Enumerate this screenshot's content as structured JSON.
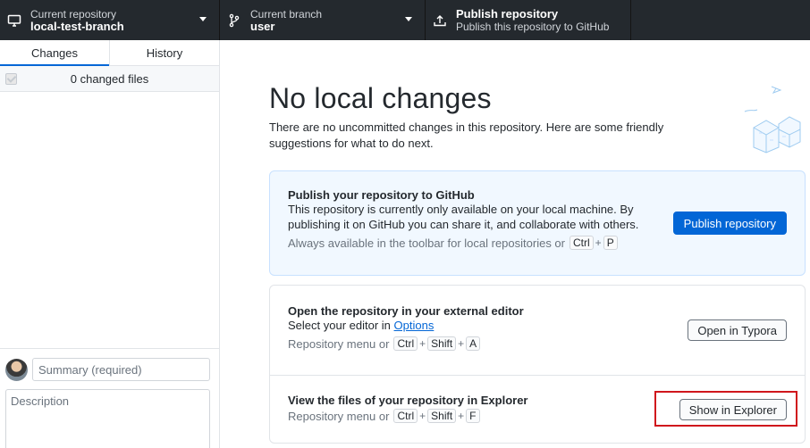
{
  "toolbar": {
    "repo": {
      "label": "Current repository",
      "value": "local-test-branch"
    },
    "branch": {
      "label": "Current branch",
      "value": "user"
    },
    "publish": {
      "label": "Publish repository",
      "desc": "Publish this repository to GitHub"
    }
  },
  "sidebar": {
    "tabs": [
      {
        "label": "Changes",
        "active": true
      },
      {
        "label": "History",
        "active": false
      }
    ],
    "changes_count": "0 changed files",
    "commit": {
      "summary_placeholder": "Summary (required)",
      "description_placeholder": "Description"
    }
  },
  "main": {
    "title": "No local changes",
    "subtitle": "There are no uncommitted changes in this repository. Here are some friendly suggestions for what to do next.",
    "publish_card": {
      "title": "Publish your repository to GitHub",
      "desc": "This repository is currently only available on your local machine. By publishing it on GitHub you can share it, and collaborate with others.",
      "hint": "Always available in the toolbar for local repositories or",
      "keys": [
        "Ctrl",
        "P"
      ],
      "button": "Publish repository"
    },
    "editor_row": {
      "title": "Open the repository in your external editor",
      "desc_prefix": "Select your editor in",
      "desc_link": "Options",
      "hint": "Repository menu or",
      "keys": [
        "Ctrl",
        "Shift",
        "A"
      ],
      "button": "Open in Typora"
    },
    "explorer_row": {
      "title": "View the files of your repository in Explorer",
      "hint": "Repository menu or",
      "keys": [
        "Ctrl",
        "Shift",
        "F"
      ],
      "button": "Show in Explorer"
    }
  },
  "colors": {
    "accent": "#0366d6",
    "toolbar": "#24292e",
    "highlight": "#d0161c",
    "info_bg": "#f1f8ff"
  },
  "icons": [
    "computer-icon",
    "branch-icon",
    "upload-icon",
    "caret-down-icon",
    "checkbox-icon",
    "avatar"
  ]
}
